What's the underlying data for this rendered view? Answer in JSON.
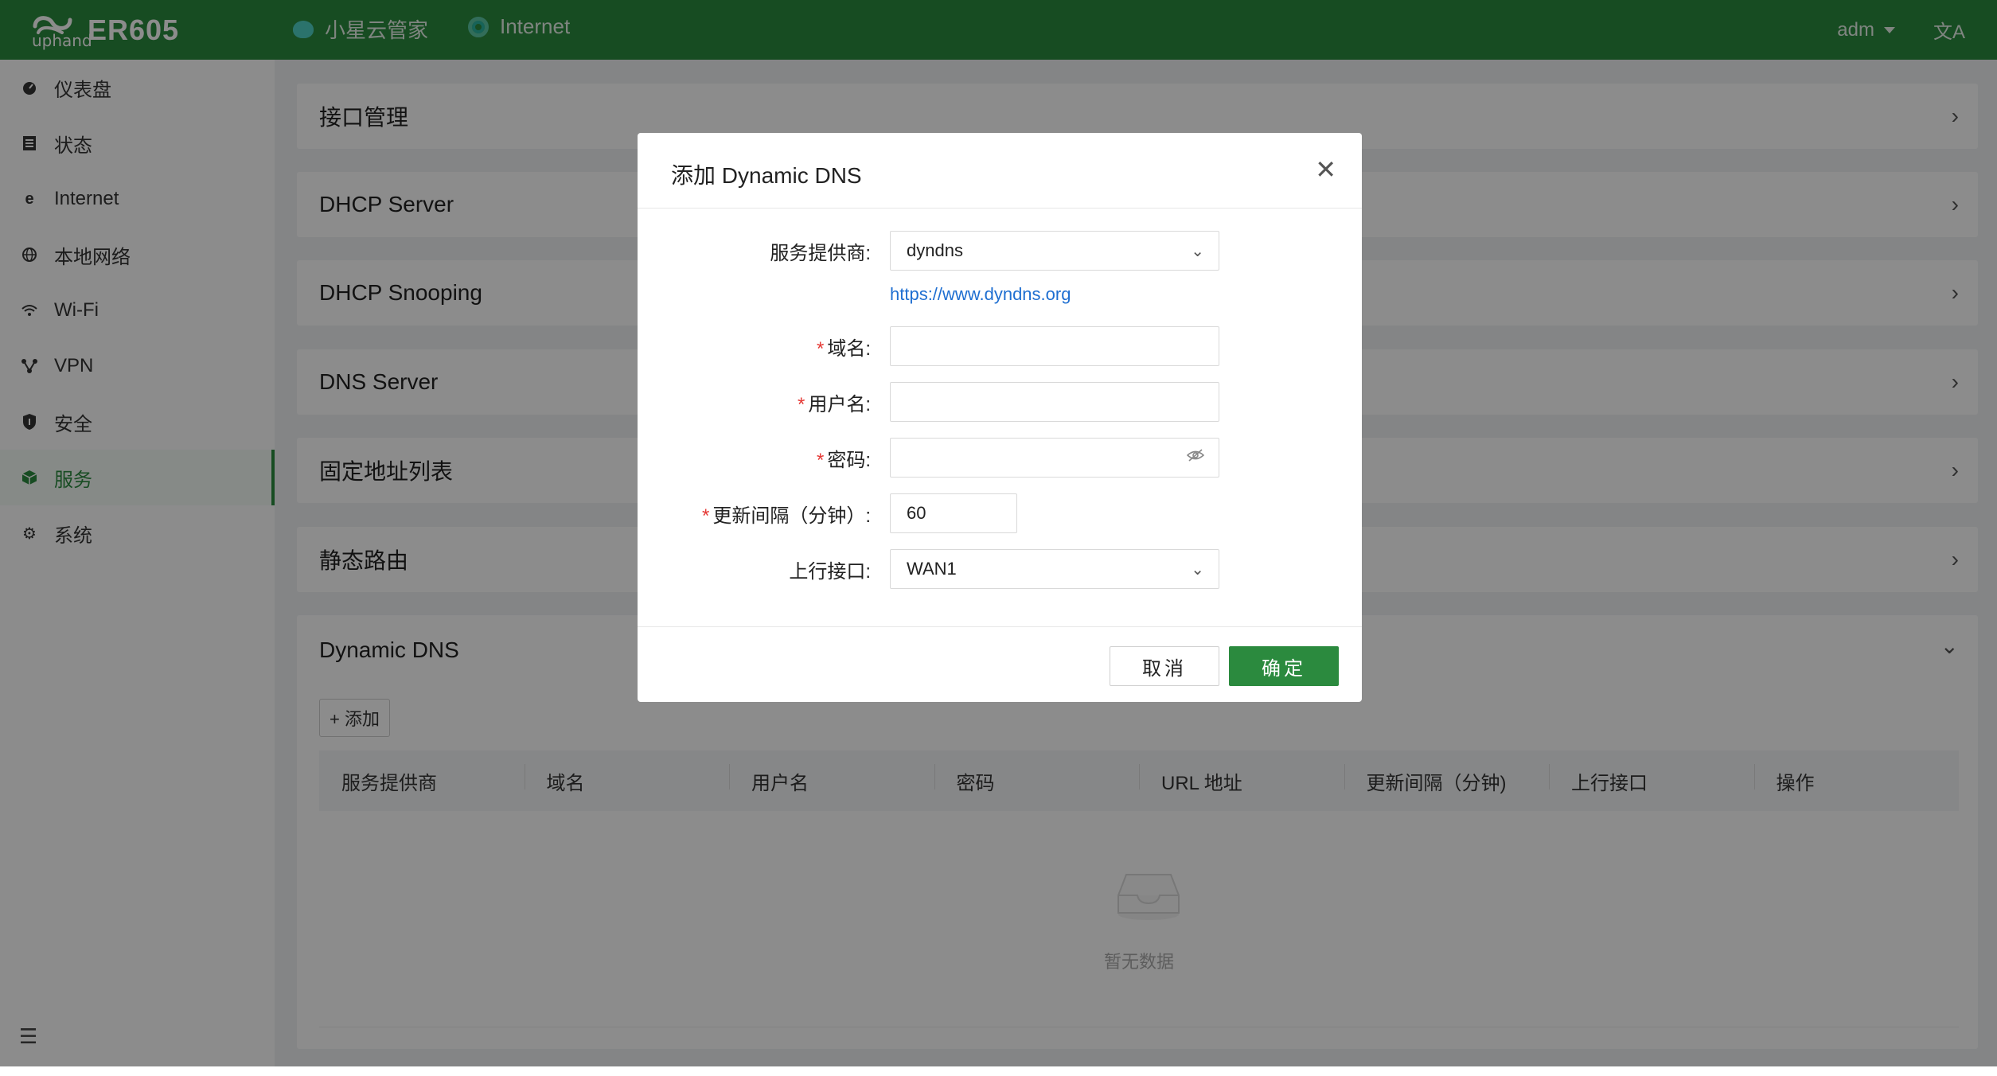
{
  "header": {
    "brand": "uphand",
    "model": "ER605",
    "cloud_label": "小星云管家",
    "internet_label": "Internet",
    "user": "adm",
    "lang_icon": "文A"
  },
  "sidebar": {
    "items": [
      {
        "label": "仪表盘",
        "icon": "dashboard-icon"
      },
      {
        "label": "状态",
        "icon": "status-icon"
      },
      {
        "label": "Internet",
        "icon": "internet-icon"
      },
      {
        "label": "本地网络",
        "icon": "globe-icon"
      },
      {
        "label": "Wi-Fi",
        "icon": "wifi-icon"
      },
      {
        "label": "VPN",
        "icon": "vpn-icon"
      },
      {
        "label": "安全",
        "icon": "shield-icon"
      },
      {
        "label": "服务",
        "icon": "cube-icon"
      },
      {
        "label": "系统",
        "icon": "gear-icon"
      }
    ],
    "active": "服务"
  },
  "main": {
    "panels": [
      "接口管理",
      "DHCP Server",
      "DHCP Snooping",
      "DNS Server",
      "固定地址列表",
      "静态路由"
    ],
    "ddns": {
      "title": "Dynamic DNS",
      "add_label": "+ 添加",
      "columns": [
        "服务提供商",
        "域名",
        "用户名",
        "密码",
        "URL 地址",
        "更新间隔（分钟)",
        "上行接口",
        "操作"
      ],
      "empty_text": "暂无数据"
    }
  },
  "modal": {
    "title": "添加 Dynamic DNS",
    "provider_label": "服务提供商:",
    "provider_value": "dyndns",
    "provider_link": "https://www.dyndns.org",
    "domain_label": "域名:",
    "username_label": "用户名:",
    "password_label": "密码:",
    "interval_label": "更新间隔（分钟）:",
    "interval_value": "60",
    "uplink_label": "上行接口:",
    "uplink_value": "WAN1",
    "required_mark": "*",
    "cancel_label": "取消",
    "ok_label": "确定"
  },
  "colors": {
    "brand_green": "#2b8a3e",
    "link_blue": "#1f6fd1",
    "required_red": "#e53935"
  }
}
